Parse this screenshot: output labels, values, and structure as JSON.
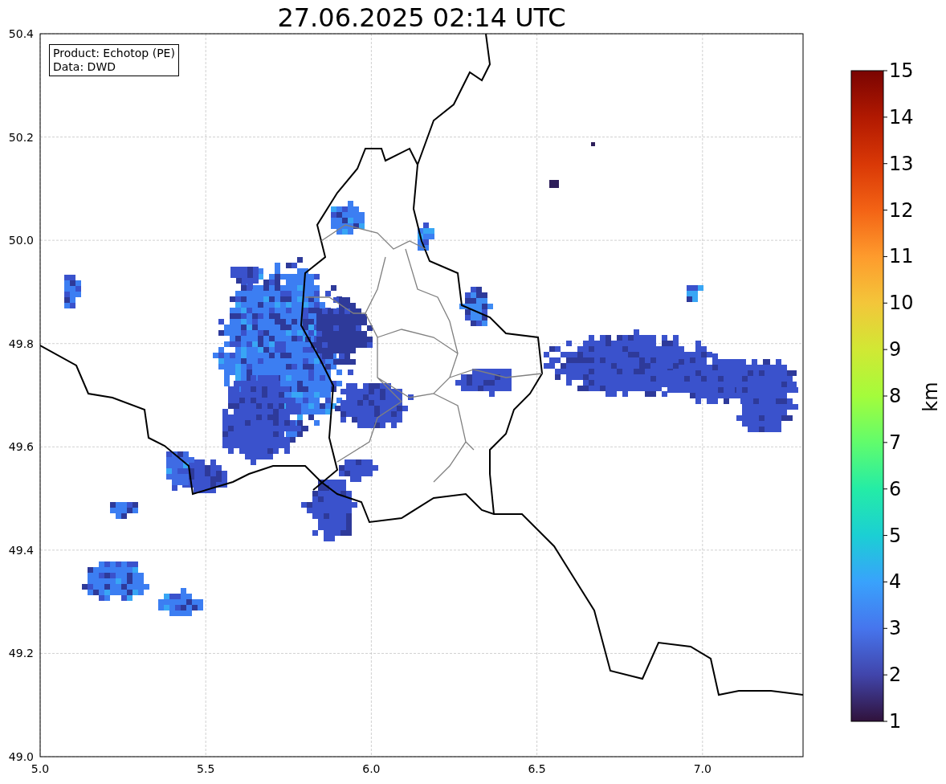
{
  "title": "27.06.2025 02:14 UTC",
  "info_box": [
    "Product: Echotop (PE)",
    "Data: DWD"
  ],
  "map": {
    "xticks": [
      "5.0",
      "5.5",
      "6.0",
      "6.5",
      "7.0"
    ],
    "yticks": [
      "50.4",
      "50.2",
      "50.0",
      "49.8",
      "49.6",
      "49.4",
      "49.2",
      "49.0"
    ]
  },
  "colorbar": {
    "label": "km",
    "ticks": [
      "15",
      "14",
      "13",
      "12",
      "11",
      "10",
      "9",
      "8",
      "7",
      "6",
      "5",
      "4",
      "3",
      "2",
      "1"
    ]
  }
}
